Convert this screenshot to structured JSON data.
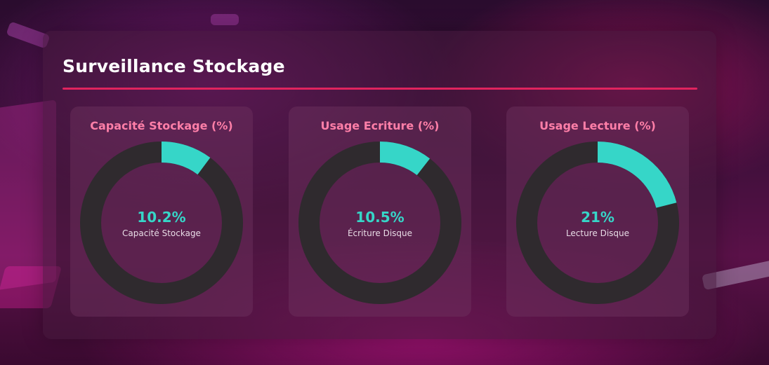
{
  "page": {
    "title": "Surveillance Stockage"
  },
  "colors": {
    "accent": "#e0245e",
    "gauge_fill": "#36d6c8",
    "gauge_track": "#2f2a2e",
    "card_title": "#ff7fa8"
  },
  "cards": [
    {
      "title": "Capacité Stockage (%)",
      "value_text": "10.2%",
      "label": "Capacité Stockage",
      "percent": 10.2
    },
    {
      "title": "Usage Ecriture (%)",
      "value_text": "10.5%",
      "label": "Écriture Disque",
      "percent": 10.5
    },
    {
      "title": "Usage Lecture (%)",
      "value_text": "21%",
      "label": "Lecture Disque",
      "percent": 21
    }
  ]
}
